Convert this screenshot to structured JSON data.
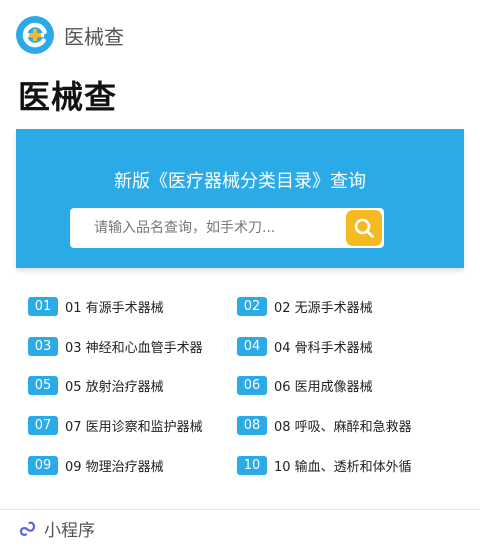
{
  "header": {
    "app_name": "医械查",
    "logo_icon": "app-logo-icon"
  },
  "page": {
    "title": "医械查"
  },
  "banner": {
    "title": "新版《医疗器械分类目录》查询",
    "search_placeholder": "请输入品名查询，如手术刀...",
    "search_icon": "search-icon",
    "color": "#2aaae6",
    "button_color": "#f5b922"
  },
  "categories": [
    {
      "num": "01",
      "label": "01 有源手术器械"
    },
    {
      "num": "02",
      "label": "02 无源手术器械"
    },
    {
      "num": "03",
      "label": "03 神经和心血管手术器"
    },
    {
      "num": "04",
      "label": "04 骨科手术器械"
    },
    {
      "num": "05",
      "label": "05 放射治疗器械"
    },
    {
      "num": "06",
      "label": "06 医用成像器械"
    },
    {
      "num": "07",
      "label": "07 医用诊察和监护器械"
    },
    {
      "num": "08",
      "label": "08 呼吸、麻醉和急救器"
    },
    {
      "num": "09",
      "label": "09 物理治疗器械"
    },
    {
      "num": "10",
      "label": "10 输血、透析和体外循"
    }
  ],
  "footer": {
    "label": "小程序",
    "icon": "mini-program-icon"
  }
}
